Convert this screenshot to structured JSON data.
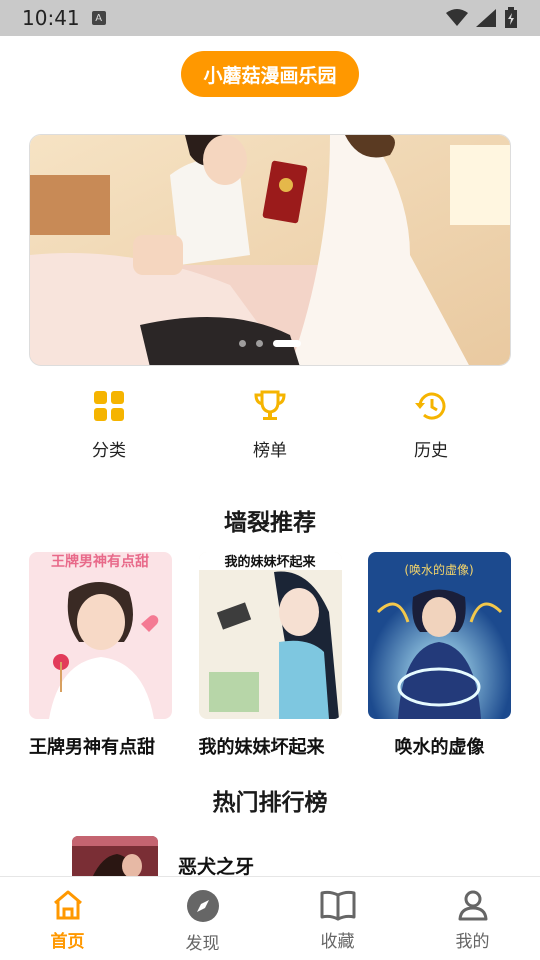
{
  "status_bar": {
    "time": "10:41",
    "notification_icon": "A"
  },
  "app": {
    "title": "小蘑菇漫画乐园"
  },
  "banner": {
    "slide_count": 3,
    "active_index": 2
  },
  "quick_actions": [
    {
      "label": "分类",
      "icon": "grid-icon"
    },
    {
      "label": "榜单",
      "icon": "trophy-icon"
    },
    {
      "label": "历史",
      "icon": "history-icon"
    }
  ],
  "recommend": {
    "title": "墙裂推荐",
    "items": [
      {
        "name": "王牌男神有点甜",
        "cover_text": "王牌男神有点甜"
      },
      {
        "name": "我的妹妹坏起来",
        "cover_text": "我的妹妹坏起来"
      },
      {
        "name": "唤水的虚像",
        "cover_text": "(唤水的虚像)"
      }
    ]
  },
  "ranking": {
    "title": "热门排行榜",
    "items": [
      {
        "name": "恶犬之牙"
      }
    ]
  },
  "tabs": [
    {
      "label": "首页",
      "icon": "home-icon",
      "active": true
    },
    {
      "label": "发现",
      "icon": "compass-icon",
      "active": false
    },
    {
      "label": "收藏",
      "icon": "book-icon",
      "active": false
    },
    {
      "label": "我的",
      "icon": "user-icon",
      "active": false
    }
  ],
  "colors": {
    "accent": "#ff9800",
    "icon_yellow": "#f5b400"
  }
}
